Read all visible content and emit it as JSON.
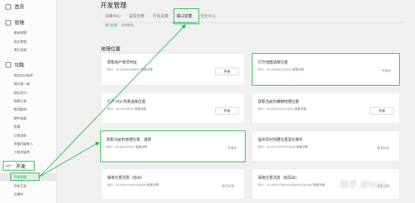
{
  "sidebar": {
    "groups": [
      {
        "label": "首页",
        "items": []
      },
      {
        "label": "管理",
        "items": [
          "版本管理",
          "成员管理",
          "用户反馈"
        ]
      },
      {
        "label": "功能",
        "items": [
          "附近的小程序",
          "微信搜一搜",
          "微信支付",
          "购物订单",
          "物流服务",
          "硬件设备",
          "客服",
          "订阅消息",
          "页面内容接入",
          "小程序插件"
        ]
      },
      {
        "label": "开发",
        "items": [
          "开发管理",
          "开发工具",
          "云服务"
        ]
      }
    ],
    "new_dot": "•"
  },
  "header": {
    "title": "开发管理",
    "tabs": [
      "运维中心",
      "监控告警",
      "开发设置",
      "接口设置",
      "安全中心"
    ],
    "active_tab": "接口设置",
    "subtabs": [
      "接口权限",
      "使用限制"
    ]
  },
  "section": {
    "title": "地理位置"
  },
  "cards": [
    {
      "title": "获取用户收货地址",
      "api_prefix": "接口：",
      "api": "wx.chooseAddress",
      "link": "查看详情",
      "action": "开通",
      "status": ""
    },
    {
      "title": "打开地图选择位置",
      "api_prefix": "接口：",
      "api": "wx.chooseLocation",
      "link": "查看详情",
      "action": "",
      "status": "申请中"
    },
    {
      "title": "打开 POI 列表选择位置",
      "api_prefix": "接口：",
      "api": "wx.choosePoi",
      "link": "查看详情",
      "action": "开通",
      "status": ""
    },
    {
      "title": "获取当前的模糊地理位置",
      "api_prefix": "接口：",
      "api": "wx.getFuzzyLocation",
      "link": "查看详情",
      "action": "开通",
      "status": ""
    },
    {
      "title": "获取当前的地理位置、速度",
      "api_prefix": "接口：",
      "api": "wx.getLocation",
      "link": "查看详情",
      "action": "",
      "status": "申请中"
    },
    {
      "title": "监听实时地理位置变化事件",
      "api_prefix": "接口：",
      "api": "wx.onLocationChange",
      "link": "查看详情",
      "action": "",
      "status": "暂无权限"
    },
    {
      "title": "接收位置消息（前台）",
      "api_prefix": "接口：",
      "api": "wx.startLocationUpdate",
      "link": "查看详情",
      "action": "",
      "status": "暂无权限"
    },
    {
      "title": "接收位置消息（前后台）",
      "api_prefix": "接口：",
      "api": "wx.startLocationUpdateBackground",
      "link": "查看详情",
      "action": "",
      "status": "暂无权限"
    }
  ],
  "watermark": "知乎 @fairy",
  "colors": {
    "accent": "#07c160",
    "highlight": "#22bb44",
    "link": "#576b95"
  }
}
